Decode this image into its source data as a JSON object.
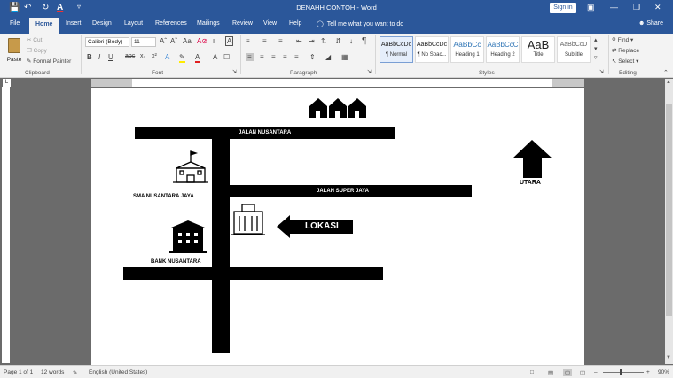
{
  "window": {
    "title": "DENAHH CONTOH  -  Word",
    "sign_in": "Sign in",
    "share": "Share"
  },
  "quick_access": {
    "save_icon": "save-icon",
    "undo_icon": "undo-icon",
    "redo_icon": "redo-icon",
    "font_color_icon": "font-color-icon"
  },
  "tabs": [
    "File",
    "Home",
    "Insert",
    "Design",
    "Layout",
    "References",
    "Mailings",
    "Review",
    "View",
    "Help"
  ],
  "tell_me": "Tell me what you want to do",
  "clipboard": {
    "paste": "Paste",
    "cut": "Cut",
    "copy": "Copy",
    "format_painter": "Format Painter",
    "group": "Clipboard"
  },
  "font": {
    "name": "Calibri (Body)",
    "size": "11",
    "group": "Font"
  },
  "paragraph": {
    "group": "Paragraph"
  },
  "styles": {
    "items": [
      {
        "preview": "AaBbCcDc",
        "name": "¶ Normal"
      },
      {
        "preview": "AaBbCcDc",
        "name": "¶ No Spac..."
      },
      {
        "preview": "AaBbCc",
        "name": "Heading 1"
      },
      {
        "preview": "AaBbCcC",
        "name": "Heading 2"
      },
      {
        "preview": "AaB",
        "name": "Title"
      },
      {
        "preview": "AaBbCcD",
        "name": "Subtitle"
      }
    ],
    "group": "Styles"
  },
  "editing": {
    "find": "Find",
    "replace": "Replace",
    "select": "Select",
    "group": "Editing"
  },
  "map": {
    "road_top": "JALAN NUSANTARA",
    "road_middle": "JALAN SUPER JAYA",
    "school": "SMA NUSANTARA JAYA",
    "bank": "BANK NUSANTARA",
    "location": "LOKASI",
    "north": "UTARA"
  },
  "status": {
    "page": "Page 1 of 1",
    "words": "12 words",
    "language": "English (United States)",
    "zoom": "90%"
  }
}
